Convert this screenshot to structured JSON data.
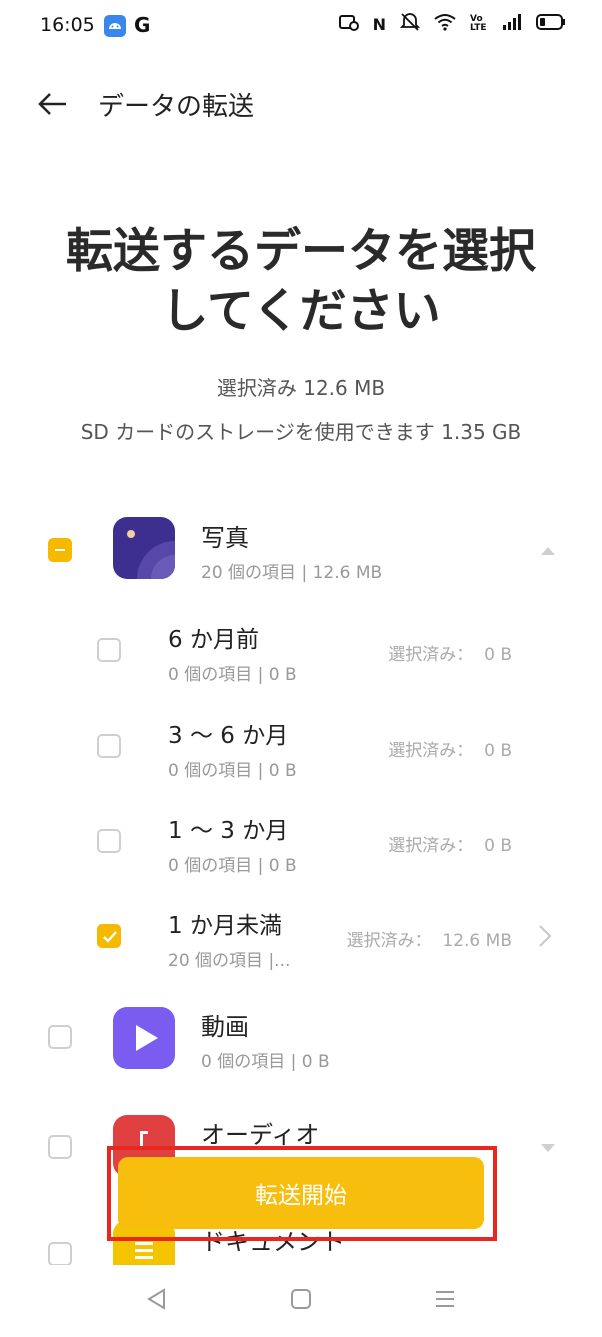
{
  "status_bar": {
    "time": "16:05",
    "app_icons": [
      "android-app-icon",
      "google-icon"
    ],
    "google_label": "G",
    "system_icons": [
      "nfc-tag-icon",
      "nfc-icon",
      "mute-icon",
      "wifi-icon",
      "volte-icon",
      "signal-icon",
      "battery-icon"
    ],
    "nfc_label": "N",
    "volte_label": "Vo LTE"
  },
  "topbar": {
    "title": "データの転送"
  },
  "heading": {
    "line1": "転送するデータを選択",
    "line2": "してください"
  },
  "summary": {
    "selected": "選択済み 12.6 MB",
    "storage": "SD カードのストレージを使用できます 1.35 GB"
  },
  "categories": [
    {
      "name": "写真",
      "meta": "20 個の項目 | 12.6 MB",
      "state": "partial",
      "icon": "photo-icon",
      "color": "#3d2f8f",
      "expanded": true,
      "subitems": [
        {
          "name": "6 か月前",
          "meta": "0 個の項目 | 0 B",
          "selected": "選択済み：  0 B",
          "checked": false
        },
        {
          "name": "3 〜 6 か月",
          "meta": "0 個の項目 | 0 B",
          "selected": "選択済み：  0 B",
          "checked": false
        },
        {
          "name": "1 〜 3 か月",
          "meta": "0 個の項目 | 0 B",
          "selected": "選択済み：  0 B",
          "checked": false
        },
        {
          "name": "1 か月未満",
          "meta": "20 個の項目 |...",
          "selected": "選択済み：  12.6 MB",
          "checked": true
        }
      ]
    },
    {
      "name": "動画",
      "meta": "0 個の項目 | 0 B",
      "state": "unchecked",
      "icon": "video-play-icon",
      "color": "#7b5cf0"
    },
    {
      "name": "オーディオ",
      "meta": "",
      "state": "unchecked",
      "icon": "audio-icon",
      "color": "#e04040"
    },
    {
      "name": "ドキュメント",
      "meta": "",
      "state": "unchecked",
      "icon": "document-icon",
      "color": "#f5c400"
    }
  ],
  "start_button": {
    "label": "転送開始"
  },
  "colors": {
    "accent": "#f8be0e",
    "highlight": "#e8281f"
  },
  "nav": [
    "back-nav-icon",
    "home-nav-icon",
    "menu-nav-icon"
  ]
}
